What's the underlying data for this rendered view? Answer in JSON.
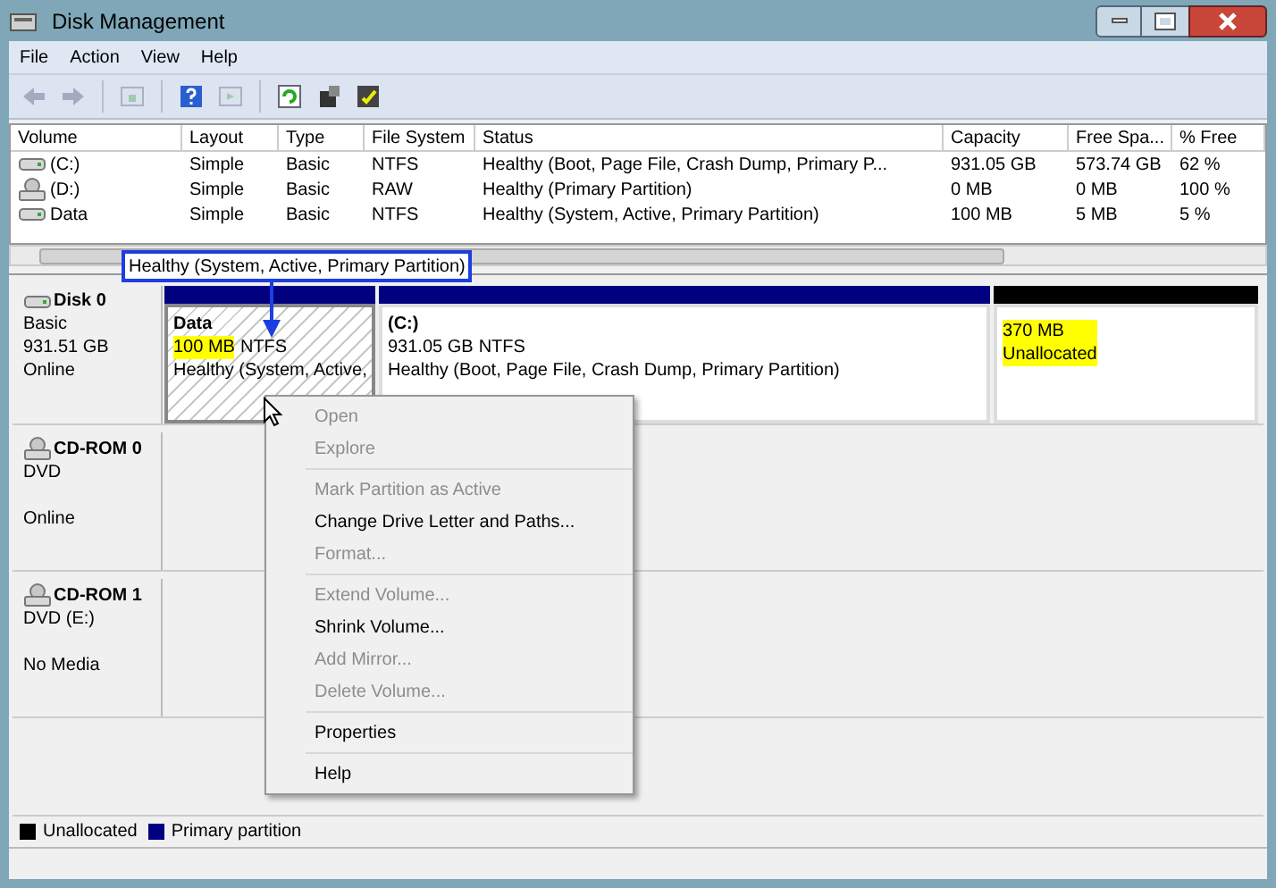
{
  "window": {
    "title": "Disk Management"
  },
  "menu": [
    "File",
    "Action",
    "View",
    "Help"
  ],
  "toolbar": [
    {
      "kind": "back",
      "disabled": true
    },
    {
      "kind": "forward",
      "disabled": true
    },
    {
      "kind": "sep"
    },
    {
      "kind": "panel",
      "disabled": true
    },
    {
      "kind": "sep"
    },
    {
      "kind": "help",
      "disabled": false
    },
    {
      "kind": "panel2",
      "disabled": true
    },
    {
      "kind": "sep"
    },
    {
      "kind": "refresh",
      "disabled": false
    },
    {
      "kind": "rescan",
      "disabled": false
    },
    {
      "kind": "props",
      "disabled": false
    }
  ],
  "table": {
    "columns": [
      "Volume",
      "Layout",
      "Type",
      "File System",
      "Status",
      "Capacity",
      "Free Spa...",
      "% Free"
    ],
    "rows": [
      {
        "kind": "hdd",
        "cells": [
          "(C:)",
          "Simple",
          "Basic",
          "NTFS",
          "Healthy (Boot, Page File, Crash Dump, Primary P...",
          "931.05 GB",
          "573.74 GB",
          "62 %"
        ]
      },
      {
        "kind": "cd",
        "cells": [
          "(D:)",
          "Simple",
          "Basic",
          "RAW",
          "Healthy (Primary Partition)",
          "0 MB",
          "0 MB",
          "100 %"
        ]
      },
      {
        "kind": "hdd",
        "cells": [
          "Data",
          "Simple",
          "Basic",
          "NTFS",
          "Healthy (System, Active, Primary Partition)",
          "100 MB",
          "5 MB",
          "5 %"
        ]
      }
    ]
  },
  "callout": "Healthy (System, Active, Primary Partition)",
  "disks": [
    {
      "kind": "hdd",
      "name": "Disk 0",
      "type": "Basic",
      "capacity": "931.51 GB",
      "status": "Online",
      "partitions": [
        {
          "kind": "primary",
          "selected": true,
          "name": "Data",
          "size": "100 MB",
          "size_highlighted": true,
          "fs": "NTFS",
          "status": "Healthy (System, Active,"
        },
        {
          "kind": "primary",
          "selected": false,
          "name": "(C:)",
          "size": "931.05 GB",
          "size_highlighted": false,
          "fs": "NTFS",
          "status": "Healthy (Boot, Page File, Crash Dump, Primary Partition)"
        },
        {
          "kind": "unallocated",
          "selected": false,
          "size": "370 MB",
          "size_highlighted": true,
          "status": "Unallocated"
        }
      ]
    },
    {
      "kind": "cd",
      "name": "CD-ROM 0",
      "type": "DVD",
      "status": "Online"
    },
    {
      "kind": "cd",
      "name": "CD-ROM 1",
      "type": "DVD (E:)",
      "status": "No Media"
    }
  ],
  "context_menu": [
    [
      {
        "label": "Open",
        "disabled": true
      },
      {
        "label": "Explore",
        "disabled": true
      }
    ],
    [
      {
        "label": "Mark Partition as Active",
        "disabled": true
      },
      {
        "label": "Change Drive Letter and Paths...",
        "disabled": false
      },
      {
        "label": "Format...",
        "disabled": true
      }
    ],
    [
      {
        "label": "Extend Volume...",
        "disabled": true
      },
      {
        "label": "Shrink Volume...",
        "disabled": false
      },
      {
        "label": "Add Mirror...",
        "disabled": true
      },
      {
        "label": "Delete Volume...",
        "disabled": true
      }
    ],
    [
      {
        "label": "Properties",
        "disabled": false
      }
    ],
    [
      {
        "label": "Help",
        "disabled": false
      }
    ]
  ],
  "legend": [
    {
      "label": "Unallocated",
      "color": "#000000"
    },
    {
      "label": "Primary partition",
      "color": "#000080"
    }
  ]
}
